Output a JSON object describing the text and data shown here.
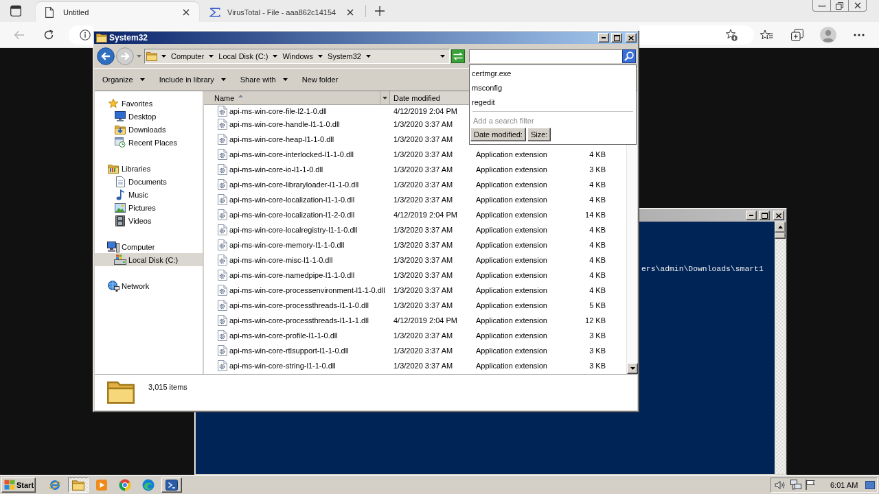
{
  "browser": {
    "tabs": [
      {
        "kind": "page",
        "title": "Untitled",
        "selected": true
      },
      {
        "kind": "sigma",
        "title": "VirusTotal - File - aaa862c14154",
        "selected": false
      }
    ],
    "nav_buttons": [
      {
        "kind": "back",
        "disabled": true
      },
      {
        "kind": "refresh",
        "disabled": false
      }
    ]
  },
  "console": {
    "lines": [
      "ers\\admin\\Downloads\\smart1"
    ]
  },
  "explorer": {
    "title": "System32",
    "breadcrumb": [
      "Computer",
      "Local Disk (C:)",
      "Windows",
      "System32"
    ],
    "commands": [
      {
        "label": "Organize",
        "menu": true
      },
      {
        "label": "Include in library",
        "menu": true
      },
      {
        "label": "Share with",
        "menu": true
      },
      {
        "label": "New folder",
        "menu": false
      }
    ],
    "navigation": [
      {
        "kind": "favorites",
        "label": "Favorites",
        "selected": false,
        "children": [
          {
            "kind": "desktop",
            "label": "Desktop",
            "selected": false
          },
          {
            "kind": "downloads",
            "label": "Downloads",
            "selected": false
          },
          {
            "kind": "recent",
            "label": "Recent Places",
            "selected": false
          }
        ]
      },
      {
        "kind": "libraries",
        "label": "Libraries",
        "selected": false,
        "children": [
          {
            "kind": "documents",
            "label": "Documents",
            "selected": false
          },
          {
            "kind": "music",
            "label": "Music",
            "selected": false
          },
          {
            "kind": "pictures",
            "label": "Pictures",
            "selected": false
          },
          {
            "kind": "videos",
            "label": "Videos",
            "selected": false
          }
        ]
      },
      {
        "kind": "computer",
        "label": "Computer",
        "selected": false,
        "children": [
          {
            "kind": "drive",
            "label": "Local Disk (C:)",
            "selected": true
          }
        ]
      },
      {
        "kind": "network",
        "label": "Network",
        "selected": false
      }
    ],
    "columns": [
      {
        "label": "Name",
        "sorted": true
      },
      {
        "label": "Date modified",
        "sorted": false
      }
    ],
    "files": [
      {
        "name": "api-ms-win-core-file-l2-1-0.dll",
        "date_modified": "4/12/2019 2:04 PM"
      },
      {
        "name": "api-ms-win-core-handle-l1-1-0.dll",
        "date_modified": "1/3/2020 3:37 AM"
      },
      {
        "name": "api-ms-win-core-heap-l1-1-0.dll",
        "date_modified": "1/3/2020 3:37 AM"
      },
      {
        "name": "api-ms-win-core-interlocked-l1-1-0.dll",
        "date_modified": "1/3/2020 3:37 AM",
        "type": "Application extension",
        "size": "4 KB"
      },
      {
        "name": "api-ms-win-core-io-l1-1-0.dll",
        "date_modified": "1/3/2020 3:37 AM",
        "type": "Application extension",
        "size": "3 KB"
      },
      {
        "name": "api-ms-win-core-libraryloader-l1-1-0.dll",
        "date_modified": "1/3/2020 3:37 AM",
        "type": "Application extension",
        "size": "4 KB"
      },
      {
        "name": "api-ms-win-core-localization-l1-1-0.dll",
        "date_modified": "1/3/2020 3:37 AM",
        "type": "Application extension",
        "size": "4 KB"
      },
      {
        "name": "api-ms-win-core-localization-l1-2-0.dll",
        "date_modified": "4/12/2019 2:04 PM",
        "type": "Application extension",
        "size": "14 KB"
      },
      {
        "name": "api-ms-win-core-localregistry-l1-1-0.dll",
        "date_modified": "1/3/2020 3:37 AM",
        "type": "Application extension",
        "size": "4 KB"
      },
      {
        "name": "api-ms-win-core-memory-l1-1-0.dll",
        "date_modified": "1/3/2020 3:37 AM",
        "type": "Application extension",
        "size": "4 KB"
      },
      {
        "name": "api-ms-win-core-misc-l1-1-0.dll",
        "date_modified": "1/3/2020 3:37 AM",
        "type": "Application extension",
        "size": "4 KB"
      },
      {
        "name": "api-ms-win-core-namedpipe-l1-1-0.dll",
        "date_modified": "1/3/2020 3:37 AM",
        "type": "Application extension",
        "size": "4 KB"
      },
      {
        "name": "api-ms-win-core-processenvironment-l1-1-0.dll",
        "date_modified": "1/3/2020 3:37 AM",
        "type": "Application extension",
        "size": "4 KB"
      },
      {
        "name": "api-ms-win-core-processthreads-l1-1-0.dll",
        "date_modified": "1/3/2020 3:37 AM",
        "type": "Application extension",
        "size": "5 KB"
      },
      {
        "name": "api-ms-win-core-processthreads-l1-1-1.dll",
        "date_modified": "4/12/2019 2:04 PM",
        "type": "Application extension",
        "size": "12 KB"
      },
      {
        "name": "api-ms-win-core-profile-l1-1-0.dll",
        "date_modified": "1/3/2020 3:37 AM",
        "type": "Application extension",
        "size": "3 KB"
      },
      {
        "name": "api-ms-win-core-rtlsupport-l1-1-0.dll",
        "date_modified": "1/3/2020 3:37 AM",
        "type": "Application extension",
        "size": "3 KB"
      },
      {
        "name": "api-ms-win-core-string-l1-1-0.dll",
        "date_modified": "1/3/2020 3:37 AM",
        "type": "Application extension",
        "size": "3 KB"
      }
    ],
    "item_count": "3,015 items",
    "search_suggestions": {
      "items": [
        "certmgr.exe",
        "msconfig",
        "regedit"
      ],
      "filter_hint": "Add a search filter",
      "filters": [
        "Date modified:",
        "Size:"
      ]
    }
  },
  "taskbar": {
    "start": "Start",
    "apps": [
      {
        "kind": "letter-e",
        "selected": false,
        "running": false
      },
      {
        "kind": "folder",
        "selected": true,
        "running": true
      },
      {
        "kind": "play",
        "selected": false,
        "running": false
      },
      {
        "kind": "ring",
        "selected": false,
        "running": false
      },
      {
        "kind": "wave",
        "selected": false,
        "running": false
      },
      {
        "kind": "terminal",
        "selected": false,
        "running": true
      }
    ],
    "clock": "6:01 AM"
  }
}
